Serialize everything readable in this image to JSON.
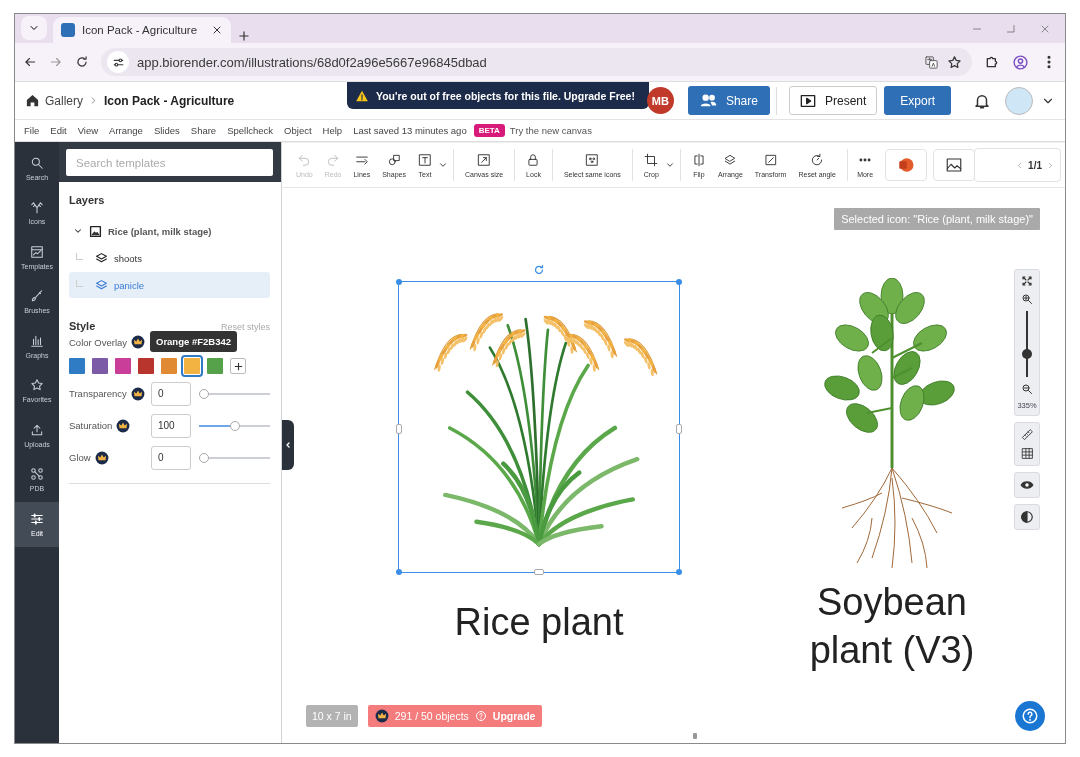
{
  "browser": {
    "tab_title": "Icon Pack - Agriculture",
    "url": "app.biorender.com/illustrations/68d0f2a96e5667e96845dbad"
  },
  "header": {
    "breadcrumb": [
      "Gallery",
      "Icon Pack - Agriculture"
    ],
    "notice": "You're out of free objects for this file. Upgrade Free!",
    "avatar": "MB",
    "buttons": [
      {
        "label": "Share",
        "kind": "share"
      },
      {
        "label": "Present",
        "kind": "present"
      },
      {
        "label": "Export",
        "kind": "export"
      }
    ]
  },
  "menu": {
    "items": [
      "File",
      "Edit",
      "View",
      "Arrange",
      "Slides",
      "Share",
      "Spellcheck",
      "Object",
      "Help"
    ],
    "saved": "Last saved 13 minutes ago",
    "badge": "BETA",
    "link": "Try the new canvas"
  },
  "rail": [
    {
      "label": "Search",
      "kind": "search",
      "selected": false
    },
    {
      "label": "Icons",
      "kind": "icons",
      "selected": false
    },
    {
      "label": "Templates",
      "kind": "templates",
      "selected": false
    },
    {
      "label": "Brushes",
      "kind": "brushes",
      "selected": false
    },
    {
      "label": "Graphs",
      "kind": "graphs",
      "selected": false
    },
    {
      "label": "Favorites",
      "kind": "favorites",
      "selected": false
    },
    {
      "label": "Uploads",
      "kind": "uploads",
      "selected": false
    },
    {
      "label": "PDB",
      "kind": "pdb",
      "selected": false
    },
    {
      "label": "Edit",
      "kind": "edit",
      "selected": true
    }
  ],
  "panel": {
    "search_placeholder": "Search templates",
    "layers_title": "Layers",
    "layers": [
      {
        "label": "Rice (plant, milk stage)",
        "expanded": true,
        "selected": false,
        "children": [
          {
            "label": "shoots",
            "selected": false
          },
          {
            "label": "panicle",
            "selected": true
          }
        ]
      }
    ],
    "style_title": "Style",
    "reset": "Reset styles",
    "color_label": "Color Overlay",
    "tooltip": "Orange #F2B342",
    "swatches": [
      {
        "color": "#2f7bc4",
        "selected": false
      },
      {
        "color": "#7b5aa6",
        "selected": false
      },
      {
        "color": "#c83e98",
        "selected": false
      },
      {
        "color": "#b8352e",
        "selected": false
      },
      {
        "color": "#e08b34",
        "selected": false
      },
      {
        "color": "#f2b342",
        "selected": true
      },
      {
        "color": "#56a24a",
        "selected": false
      }
    ],
    "sliders": [
      {
        "label": "Transparency",
        "value": "0",
        "level": 0
      },
      {
        "label": "Saturation",
        "value": "100",
        "level": 0.5
      },
      {
        "label": "Glow",
        "value": "0",
        "level": 0
      }
    ]
  },
  "toolbar": {
    "tool_groups": [
      [
        {
          "label": "Undo",
          "kind": "undo",
          "disabled": true,
          "menu": false
        },
        {
          "label": "Redo",
          "kind": "redo",
          "disabled": true,
          "menu": false
        },
        {
          "label": "Lines",
          "kind": "lines",
          "disabled": false,
          "menu": false
        },
        {
          "label": "Shapes",
          "kind": "shapes",
          "disabled": false,
          "menu": false
        },
        {
          "label": "Text",
          "kind": "text",
          "disabled": false,
          "menu": true
        }
      ],
      [
        {
          "label": "Canvas size",
          "kind": "canvas-size",
          "disabled": false,
          "menu": false
        }
      ],
      [
        {
          "label": "Lock",
          "kind": "lock",
          "disabled": false,
          "menu": false
        }
      ],
      [
        {
          "label": "Select same icons",
          "kind": "select-same",
          "disabled": false,
          "menu": false
        }
      ],
      [
        {
          "label": "Crop",
          "kind": "crop",
          "disabled": false,
          "menu": true
        }
      ],
      [
        {
          "label": "Flip",
          "kind": "flip",
          "disabled": false,
          "menu": false
        },
        {
          "label": "Arrange",
          "kind": "arrange",
          "disabled": false,
          "menu": false
        },
        {
          "label": "Transform",
          "kind": "transform",
          "disabled": false,
          "menu": false
        },
        {
          "label": "Reset angle",
          "kind": "reset-angle",
          "disabled": false,
          "menu": false
        }
      ]
    ],
    "more": "More",
    "page": "1/1"
  },
  "canvas": {
    "selected_label": "Selected icon: \"Rice (plant, milk stage)\"",
    "captions": [
      "Rice plant",
      "Soybean plant (V3)"
    ],
    "zoom": {
      "level": 0.35,
      "reading": "335%"
    },
    "size": "10 x 7 in",
    "objects": "291 / 50 objects",
    "upgrade": "Upgrade"
  }
}
